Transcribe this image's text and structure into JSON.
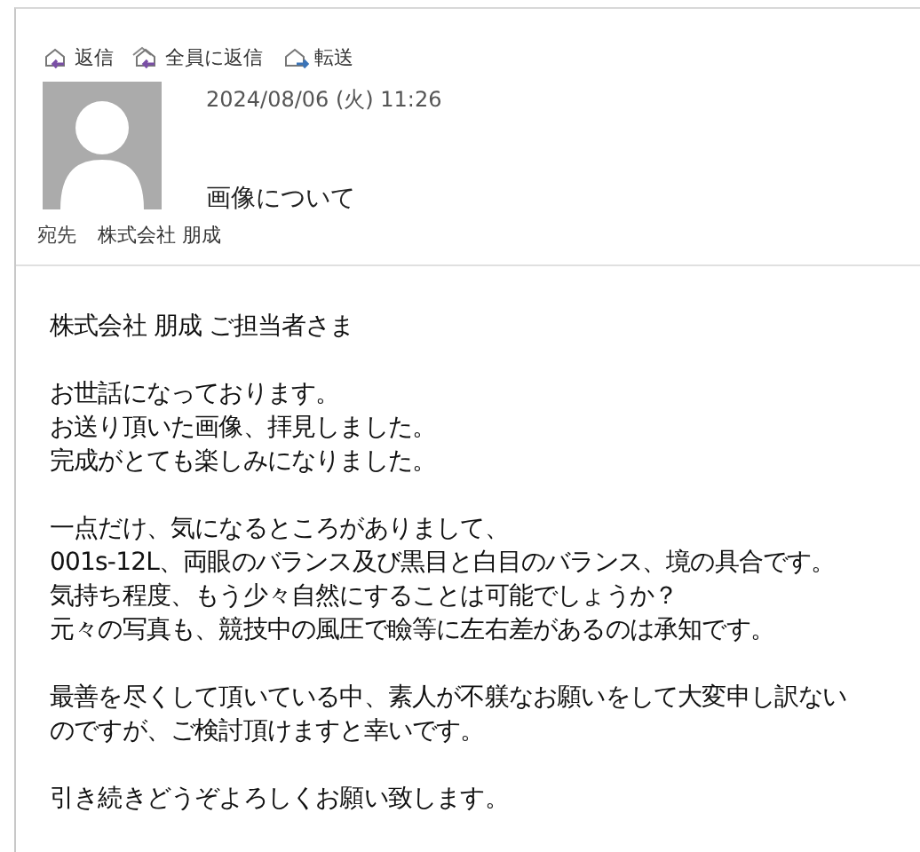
{
  "toolbar": [
    {
      "kind": "reply",
      "label": "返信"
    },
    {
      "kind": "reply_all",
      "label": "全員に返信"
    },
    {
      "kind": "forward",
      "label": "転送"
    }
  ],
  "header": {
    "date": "2024/08/06 (火) 11:26",
    "subject": "画像について",
    "to_label": "宛先",
    "to": "株式会社 朋成"
  },
  "body": [
    [
      "株式会社 朋成 ご担当者さま"
    ],
    [
      "お世話になっております。",
      "お送り頂いた画像、拝見しました。",
      "完成がとても楽しみになりました。"
    ],
    [
      "一点だけ、気になるところがありまして、",
      "001s-12L、両眼のバランス及び黒目と白目のバランス、境の具合です。",
      "気持ち程度、もう少々自然にすることは可能でしょうか？",
      "元々の写真も、競技中の風圧で瞼等に左右差があるのは承知です。"
    ],
    [
      "最善を尽くして頂いている中、素人が不躾なお願いをして大変申し訳ない",
      "のですが、ご検討頂けますと幸いです。"
    ],
    [
      "引き続きどうぞよろしくお願い致します。"
    ]
  ]
}
